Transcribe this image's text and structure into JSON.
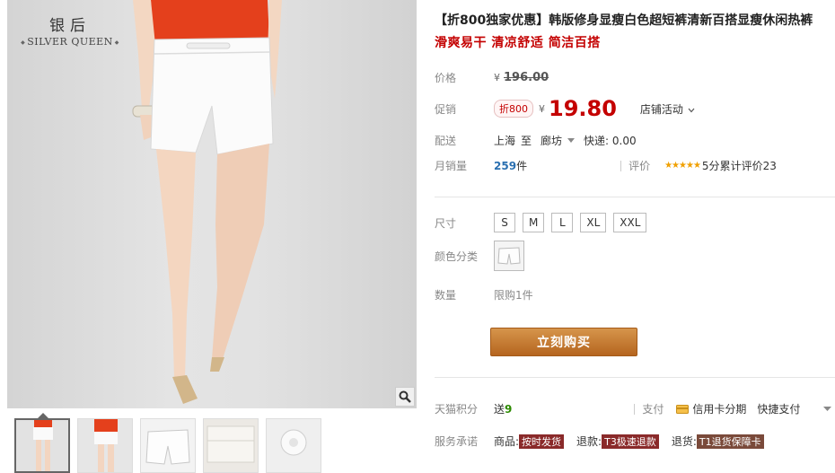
{
  "brand": {
    "cn": "银后",
    "en": "SILVER QUEEN"
  },
  "product": {
    "title": "【折800独家优惠】韩版修身显瘦白色超短裤清新百搭显瘦休闲热裤",
    "subtitle": "滑爽易干 清凉舒适 简洁百搭"
  },
  "price": {
    "label": "价格",
    "currency": "¥",
    "original": "196.00"
  },
  "promo": {
    "label": "促销",
    "tag": "折800",
    "currency": "¥",
    "price": "19.80",
    "shop_activity": "店铺活动",
    "chevron_icon": "chevron-down-icon"
  },
  "shipping": {
    "label": "配送",
    "from": "上海",
    "to_word": "至",
    "dest": "廊坊",
    "express": "快递: 0.00"
  },
  "sales": {
    "label": "月销量",
    "count": "259",
    "unit": "件",
    "review_label": "评价",
    "stars": "★★★★★",
    "score": "5分",
    "review_total": "累计评价23"
  },
  "size": {
    "label": "尺寸",
    "options": [
      "S",
      "M",
      "L",
      "XL",
      "XXL"
    ]
  },
  "color": {
    "label": "颜色分类"
  },
  "quantity": {
    "label": "数量",
    "limit": "限购1件"
  },
  "buy_button": "立刻购买",
  "points": {
    "label": "天猫积分",
    "give": "送",
    "value": "9"
  },
  "payment": {
    "label": "支付",
    "credit": "信用卡分期",
    "quick": "快捷支付"
  },
  "service": {
    "label": "服务承诺",
    "goods": "商品:",
    "goods_badge": "按时发货",
    "refund": "退款:",
    "refund_badge": "T3极速退款",
    "return": "退货:",
    "return_badge": "T1退货保障卡"
  },
  "colors": {
    "accent": "#c40000",
    "button": "#c07a34",
    "green": "#2c8a00"
  }
}
